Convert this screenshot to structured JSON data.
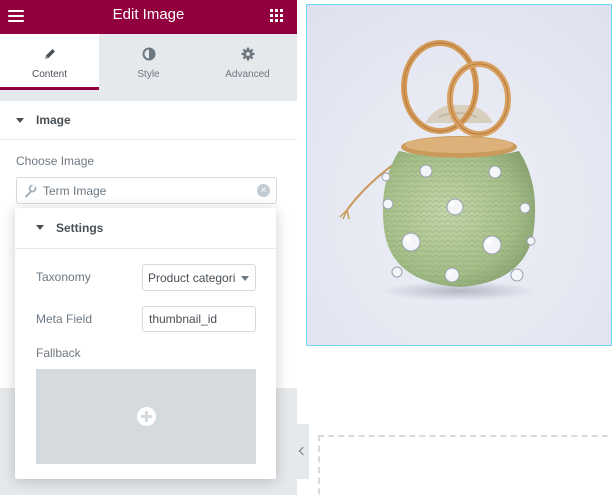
{
  "header": {
    "title": "Edit Image"
  },
  "tabs": [
    {
      "label": "Content",
      "icon": "pencil-icon",
      "active": true
    },
    {
      "label": "Style",
      "icon": "half-circle-icon",
      "active": false
    },
    {
      "label": "Advanced",
      "icon": "gear-icon",
      "active": false
    }
  ],
  "section": {
    "title": "Image"
  },
  "choose_image": {
    "label": "Choose Image",
    "value": "Term Image"
  },
  "settings_popover": {
    "title": "Settings",
    "taxonomy": {
      "label": "Taxonomy",
      "value": "Product categori"
    },
    "meta_field": {
      "label": "Meta Field",
      "value": "thumbnail_id"
    },
    "fallback": {
      "label": "Fallback"
    }
  },
  "colors": {
    "brand": "#93003f",
    "panel_bg": "#e6e9ec",
    "selection_outline": "#71d7f7",
    "placeholder_bg": "#d5dadf"
  }
}
